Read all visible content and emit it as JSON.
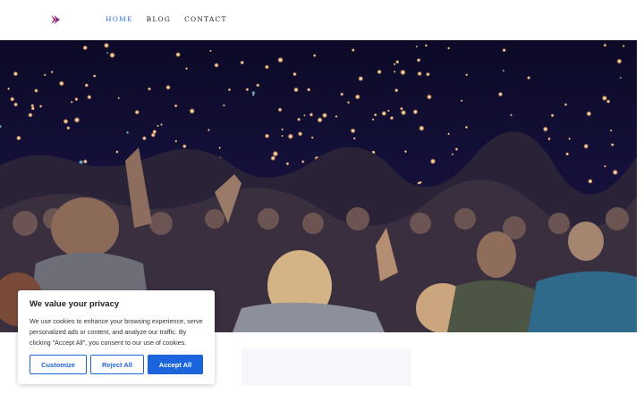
{
  "nav": {
    "items": [
      "HOME",
      "BLOG",
      "CONTACT"
    ],
    "active": "HOME"
  },
  "logo": {
    "icon": "chevron-right-icon",
    "colors": [
      "#b3246b",
      "#7c2a86"
    ]
  },
  "hero": {
    "image": "concert-crowd-photo"
  },
  "cookie": {
    "title": "We value your privacy",
    "text": "We use cookies to enhance your browsing experience, serve personalized ads or content, and analyze our traffic. By clicking \"Accept All\", you consent to our use of cookies.",
    "customize_label": "Customize",
    "reject_label": "Reject All",
    "accept_label": "Accept All"
  },
  "colors": {
    "accent": "#2f6fd8",
    "button_blue": "#1a64dc"
  }
}
